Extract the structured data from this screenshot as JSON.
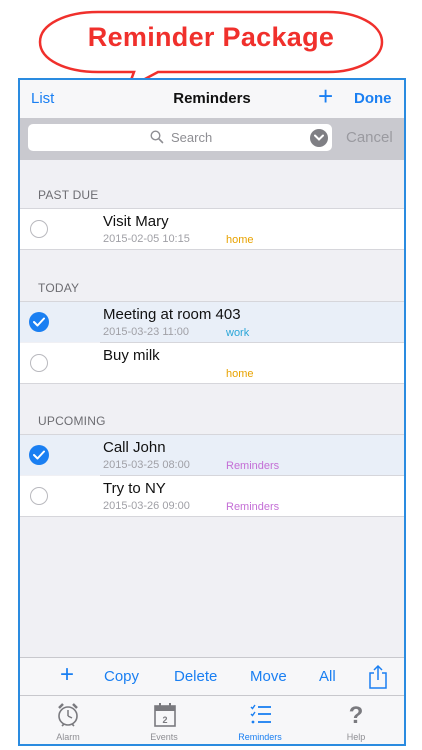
{
  "banner": {
    "title": "Reminder Package"
  },
  "navbar": {
    "left_label": "List",
    "title": "Reminders",
    "add_glyph": "+",
    "done_label": "Done"
  },
  "search": {
    "placeholder": "Search",
    "cancel_label": "Cancel"
  },
  "sections": [
    {
      "header": "PAST DUE"
    },
    {
      "header": "TODAY"
    },
    {
      "header": "UPCOMING"
    }
  ],
  "rows": [
    {
      "title": "Visit Mary",
      "date": "2015-02-05 10:15",
      "tag": "home",
      "tag_color": "#e8a200",
      "checked": false
    },
    {
      "title": "Meeting at room 403",
      "date": "2015-03-23 11:00",
      "tag": "work",
      "tag_color": "#2aa6d8",
      "checked": true
    },
    {
      "title": "Buy milk",
      "date": "",
      "tag": "home",
      "tag_color": "#e8a200",
      "checked": false
    },
    {
      "title": "Call John",
      "date": "2015-03-25 08:00",
      "tag": "Reminders",
      "tag_color": "#c46ed6",
      "checked": true
    },
    {
      "title": "Try to NY",
      "date": "2015-03-26 09:00",
      "tag": "Reminders",
      "tag_color": "#c46ed6",
      "checked": false
    }
  ],
  "toolbar": {
    "add_glyph": "+",
    "copy": "Copy",
    "delete": "Delete",
    "move": "Move",
    "all": "All",
    "share_icon": "share-icon"
  },
  "tabs": [
    {
      "label": "Alarm",
      "icon": "alarm-clock-icon",
      "active": false
    },
    {
      "label": "Events",
      "icon": "calendar-icon",
      "active": false
    },
    {
      "label": "Reminders",
      "icon": "list-icon",
      "active": true
    },
    {
      "label": "Help",
      "icon": "question-mark-icon",
      "active": false
    }
  ],
  "colors": {
    "accent": "#1a7ff2",
    "banner_text": "#f0302c",
    "frame_border": "#2a8be0"
  }
}
